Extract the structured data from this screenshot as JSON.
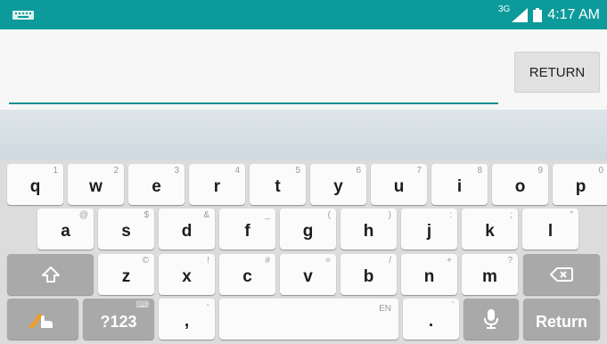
{
  "status_bar": {
    "network": "3G",
    "time": "4:17 AM",
    "keyboard_indicator_icon": "keyboard-icon",
    "signal_icon": "signal-icon",
    "battery_icon": "battery-icon"
  },
  "app": {
    "return_button": "RETURN"
  },
  "keyboard": {
    "row1": [
      {
        "label": "q",
        "hint": "1"
      },
      {
        "label": "w",
        "hint": "2"
      },
      {
        "label": "e",
        "hint": "3"
      },
      {
        "label": "r",
        "hint": "4"
      },
      {
        "label": "t",
        "hint": "5"
      },
      {
        "label": "y",
        "hint": "6"
      },
      {
        "label": "u",
        "hint": "7"
      },
      {
        "label": "i",
        "hint": "8"
      },
      {
        "label": "o",
        "hint": "9"
      },
      {
        "label": "p",
        "hint": "0"
      }
    ],
    "row2": [
      {
        "label": "a",
        "hint": "@"
      },
      {
        "label": "s",
        "hint": "$"
      },
      {
        "label": "d",
        "hint": "&"
      },
      {
        "label": "f",
        "hint": "_"
      },
      {
        "label": "g",
        "hint": "("
      },
      {
        "label": "h",
        "hint": ")"
      },
      {
        "label": "j",
        "hint": ":"
      },
      {
        "label": "k",
        "hint": ";"
      },
      {
        "label": "l",
        "hint": "\""
      }
    ],
    "row3": [
      {
        "label": "z",
        "hint": "©"
      },
      {
        "label": "x",
        "hint": "!"
      },
      {
        "label": "c",
        "hint": "#"
      },
      {
        "label": "v",
        "hint": "="
      },
      {
        "label": "b",
        "hint": "/"
      },
      {
        "label": "n",
        "hint": "+"
      },
      {
        "label": "m",
        "hint": "?"
      }
    ],
    "shift_icon": "shift-icon",
    "backspace_icon": "backspace-icon",
    "symbols_label": "?123",
    "symbols_hint": "⌨",
    "comma_label": ",",
    "comma_hint": "-",
    "space_hint": "EN",
    "period_label": ".",
    "period_hint": "'",
    "mic_icon": "mic-icon",
    "return_label": "Return",
    "swype_icon": "swype-icon"
  }
}
